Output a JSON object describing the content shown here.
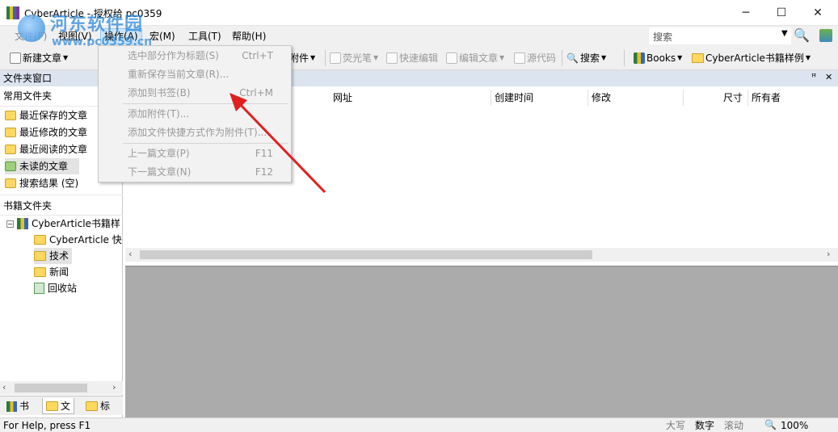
{
  "window": {
    "title": "CyberArticle - 授权给 pc0359",
    "min": "─",
    "max": "☐",
    "close": "✕"
  },
  "watermark": {
    "brand": "河东软件园",
    "url": "www.pc0359.cn"
  },
  "menubar": {
    "file": "文件(F)",
    "view": "视图(V)",
    "operation": "操作(A)",
    "macro": "宏(M)",
    "tools": "工具(T)",
    "help": "帮助(H)",
    "search_label": "搜索"
  },
  "toolbar": {
    "new_article": "新建文章",
    "attachment": "附件",
    "highlighter": "荧光笔",
    "quick_edit": "快速编辑",
    "edit_article": "编辑文章",
    "source_code": "源代码",
    "search": "搜索",
    "books": "Books",
    "book_sample": "CyberArticle书籍样例"
  },
  "left_panel": {
    "header": "文件夹窗口",
    "common_title": "常用文件夹",
    "common_items": [
      "最近保存的文章",
      "最近修改的文章",
      "最近阅读的文章",
      "未读的文章",
      "搜索结果 (空)"
    ],
    "book_title": "书籍文件夹",
    "tree_root": "CyberArticle书籍样",
    "tree_items": [
      "CyberArticle 快",
      "技术",
      "新闻",
      "回收站"
    ],
    "tabs": [
      "书",
      "文",
      "标"
    ]
  },
  "list": {
    "pin": "ꟸ",
    "close": "✕",
    "columns": [
      "网址",
      "创建时间",
      "修改",
      "尺寸",
      "所有者"
    ]
  },
  "dropdown": {
    "items": [
      {
        "label": "选中部分作为标题(S)",
        "shortcut": "Ctrl+T"
      },
      {
        "label": "重新保存当前文章(R)...",
        "shortcut": ""
      },
      {
        "label": "添加到书签(B)",
        "shortcut": "Ctrl+M"
      },
      {
        "label": "添加附件(T)...",
        "shortcut": ""
      },
      {
        "label": "添加文件快捷方式作为附件(T)...",
        "shortcut": ""
      },
      {
        "label": "上一篇文章(P)",
        "shortcut": "F11"
      },
      {
        "label": "下一篇文章(N)",
        "shortcut": "F12"
      }
    ]
  },
  "statusbar": {
    "help": "For Help, press F1",
    "caps": "大写",
    "num": "数字",
    "scroll": "滚动",
    "zoom": "100%"
  },
  "colors": {
    "panel_header": "#dbe4ef",
    "preview_bg": "#ababab",
    "arrow": "#e02020"
  }
}
